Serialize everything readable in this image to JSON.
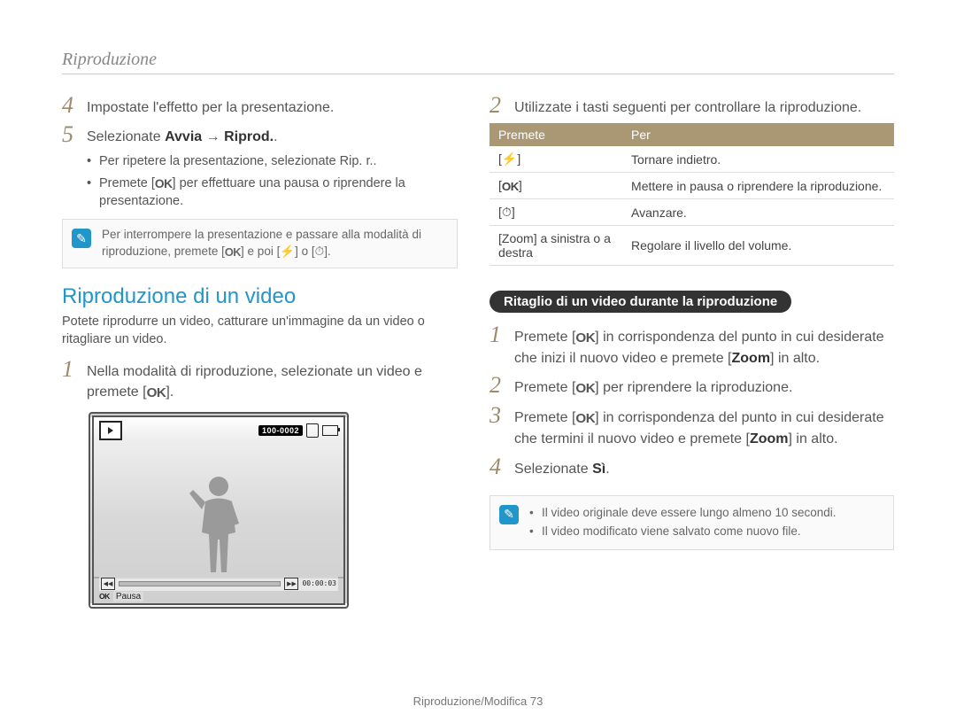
{
  "breadcrumb": "Riproduzione",
  "left": {
    "step4": "Impostate l'effetto per la presentazione.",
    "step5_pre": "Selezionate ",
    "step5_b1": "Avvia",
    "step5_arrow": " → ",
    "step5_b2": "Riprod.",
    "step5_post": ".",
    "bullets": {
      "b1_pre": "Per ripetere la presentazione, selezionate ",
      "b1_b": "Rip. r.",
      "b1_post": ".",
      "b2_pre": "Premete [",
      "b2_ok": "OK",
      "b2_post": "] per effettuare una pausa o riprendere la presentazione."
    },
    "note1_pre": "Per interrompere la presentazione e passare alla modalità di riproduzione, premete [",
    "note1_ok": "OK",
    "note1_mid": "] e poi [",
    "note1_icon1": "⚡",
    "note1_or": "] o [",
    "note1_icon2": "⏱",
    "note1_end": "].",
    "section_title": "Riproduzione di un video",
    "section_sub": "Potete riprodurre un video, catturare un'immagine da un video o ritagliare un video.",
    "step1_pre": "Nella modalità di riproduzione, selezionate un video e premete [",
    "step1_ok": "OK",
    "step1_post": "].",
    "screen": {
      "counter": "100-0002",
      "timecode": "00:00:03",
      "ok": "OK",
      "pausa": "Pausa"
    }
  },
  "right": {
    "step2": "Utilizzate i tasti seguenti per controllare la riproduzione.",
    "table": {
      "h1": "Premete",
      "h2": "Per",
      "r1_key": "⚡",
      "r1_val": "Tornare indietro.",
      "r2_key": "OK",
      "r2_val": "Mettere in pausa o riprendere la riproduzione.",
      "r3_key": "⏱",
      "r3_val": "Avanzare.",
      "r4_key_pre": "[",
      "r4_key_b": "Zoom",
      "r4_key_post": "] a sinistra o a destra",
      "r4_val": "Regolare il livello del volume."
    },
    "pill": "Ritaglio di un video durante la riproduzione",
    "s1_pre": "Premete [",
    "s1_ok": "OK",
    "s1_mid": "] in corrispondenza del punto in cui desiderate che inizi il nuovo video e premete [",
    "s1_b": "Zoom",
    "s1_post": "] in alto.",
    "s2_pre": "Premete [",
    "s2_ok": "OK",
    "s2_post": "] per riprendere la riproduzione.",
    "s3_pre": "Premete [",
    "s3_ok": "OK",
    "s3_mid": "] in corrispondenza del punto in cui desiderate che termini il nuovo video e premete [",
    "s3_b": "Zoom",
    "s3_post": "] in alto.",
    "s4_pre": "Selezionate ",
    "s4_b": "Sì",
    "s4_post": ".",
    "note2_b1": "Il video originale deve essere lungo almeno 10 secondi.",
    "note2_b2": "Il video modificato viene salvato come nuovo file."
  },
  "footer_pre": "Riproduzione/Modifica  ",
  "footer_num": "73"
}
